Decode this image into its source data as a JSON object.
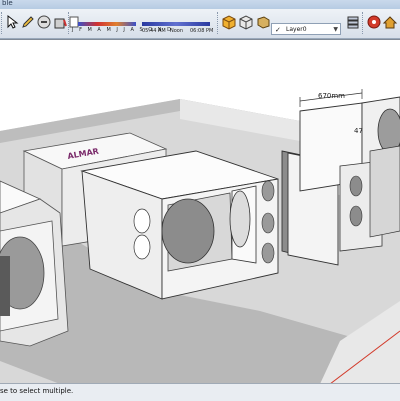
{
  "window": {
    "title_fragment": "ble"
  },
  "toolbar": {
    "months": "J F M A M J J A S O N D",
    "time_start": "05:44 AM",
    "noon_label": "Noon",
    "time_end": "06:08 PM",
    "layer": {
      "name": "Layer0",
      "check": "✓",
      "dropdown": "▼"
    },
    "icons": [
      "select-tool-icon",
      "pencil-tool-icon",
      "eraser-tool-icon",
      "paint-bucket-icon",
      "shadow-settings-icon",
      "month-slider",
      "time-slider",
      "components-icon",
      "cube-view-icon",
      "measure-cube-icon",
      "layer-manager-icon",
      "location-icon",
      "3d-warehouse-icon",
      "camera-icon"
    ]
  },
  "viewport": {
    "dimension_label": "670mm",
    "dimension_label_side": "47",
    "logo_text": "ALMAR"
  },
  "status": {
    "message": "se to select multiple."
  },
  "colors": {
    "accent_red": "#d23a2a",
    "toolbar_bg": "#e4eaf1"
  }
}
